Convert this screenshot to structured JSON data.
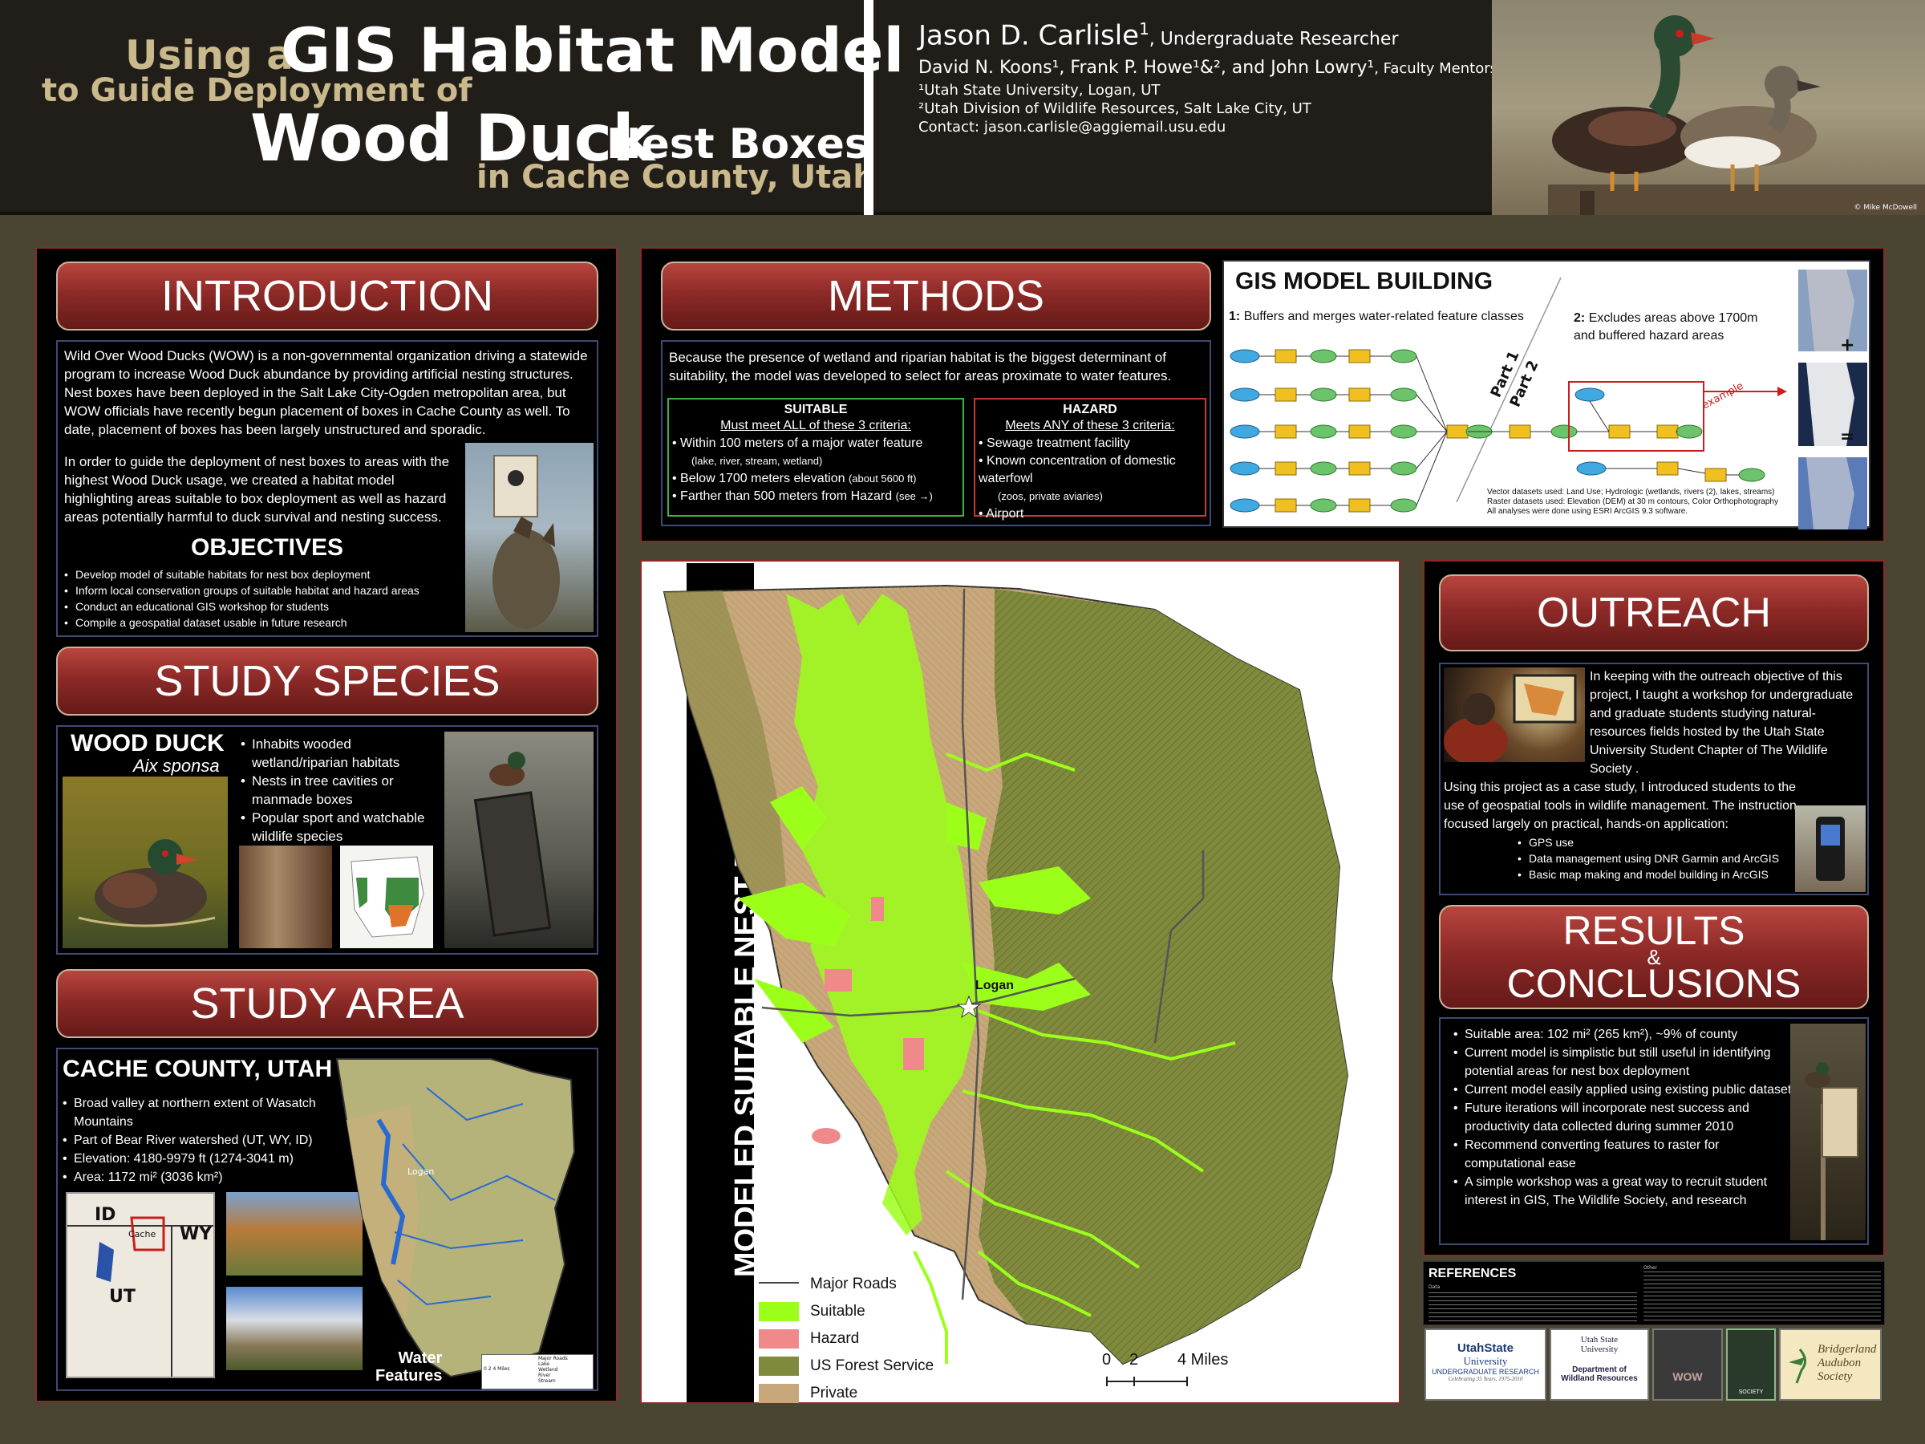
{
  "header": {
    "title_using_a": "Using a",
    "title_gis": "GIS Habitat Model",
    "title_guide": "to Guide Deployment of",
    "title_wood_duck": "Wood Duck",
    "title_nest_boxes": "Nest Boxes",
    "title_cache": "in Cache County, Utah",
    "lead_author": "Jason D. Carlisle",
    "lead_sup": "1",
    "lead_role": ", Undergraduate Researcher",
    "mentors": "David N. Koons¹, Frank P. Howe¹&², and John Lowry¹",
    "mentors_role": ", Faculty Mentors",
    "affil1": "¹Utah State University, Logan, UT",
    "affil2": "²Utah Division of Wildlife Resources, Salt Lake City, UT",
    "contact": "Contact: jason.carlisle@aggiemail.usu.edu",
    "photo_credit": "© Mike McDowell"
  },
  "introduction": {
    "banner": "INTRODUCTION",
    "para1": "Wild Over Wood Ducks (WOW) is a non-governmental organization driving a statewide program to increase Wood Duck abundance by providing artificial nesting structures.  Nest boxes have been deployed in the Salt Lake City-Ogden metropolitan area, but WOW officials have recently begun placement of boxes in Cache County as well.  To date, placement of boxes has been largely unstructured and sporadic.",
    "para2": "In order to guide the deployment of nest boxes to areas with the highest Wood Duck usage, we created a habitat model highlighting areas suitable to box deployment as well as hazard areas potentially harmful to duck survival and nesting success.",
    "objectives_title": "OBJECTIVES",
    "objectives": [
      "Develop model of suitable habitats for nest box deployment",
      "Inform local conservation groups of suitable habitat and hazard areas",
      "Conduct an educational GIS workshop for students",
      "Compile a geospatial dataset usable in future research"
    ]
  },
  "study_species": {
    "banner": "STUDY SPECIES",
    "name": "WOOD DUCK",
    "latin": "Aix sponsa",
    "bullets": [
      "Inhabits wooded wetland/riparian habitats",
      "Nests in tree cavities or manmade boxes",
      "Popular sport and watchable wildlife species"
    ]
  },
  "study_area": {
    "banner": "STUDY AREA",
    "title": "CACHE COUNTY, UTAH",
    "bullets": [
      "Broad valley at northern extent of Wasatch Mountains",
      "Part of Bear River watershed (UT, WY, ID)",
      "Elevation: 4180-9979 ft (1274-3041 m)",
      "Area: 1172 mi² (3036 km²)"
    ],
    "map_labels": {
      "id": "ID",
      "wy": "WY",
      "ut": "UT",
      "cache": "Cache"
    },
    "water_title_1": "Water",
    "water_title_2": "Features",
    "logan": "Logan",
    "legend_items": [
      "Major Roads",
      "Lake",
      "Wetland",
      "River",
      "Stream"
    ],
    "scale": "0 2 4 Miles"
  },
  "methods": {
    "banner": "METHODS",
    "intro": "Because the presence of wetland and riparian habitat is the biggest determinant of suitability, the model was developed to select for areas proximate to water features.",
    "suitable_title": "SUITABLE",
    "suitable_sub": "Must meet ALL of these 3 criteria:",
    "suitable_items": [
      "Within 100 meters of a major water feature",
      "(lake, river, stream, wetland)",
      "Below 1700 meters elevation",
      "(about 5600 ft)",
      "Farther than 500 meters from Hazard",
      "(see →)"
    ],
    "hazard_title": "HAZARD",
    "hazard_sub": "Meets ANY of these 3 criteria:",
    "hazard_items": [
      "Sewage treatment facility",
      "Known concentration of domestic waterfowl",
      "(zoos, private aviaries)",
      "Airport"
    ]
  },
  "gis_model": {
    "title": "GIS MODEL BUILDING",
    "step1_num": "1:",
    "step1": "Buffers and merges water-related feature classes",
    "step2_num": "2:",
    "step2": "Excludes areas above 1700m and buffered hazard areas",
    "part1": "Part 1",
    "part2": "Part 2",
    "example": "example",
    "note1": "Vector datasets used: Land Use; Hydrologic (wetlands, rivers (2), lakes, streams)",
    "note2": "Raster datasets used: Elevation (DEM) at 30 m contours, Color Orthophotography",
    "note3": "All analyses were done using ESRI ArcGIS 9.3 software.",
    "plus": "+",
    "equals": "="
  },
  "main_map": {
    "title": "MODELED SUITABLE NEST BOX HABITAT",
    "city": "Logan",
    "legend": [
      {
        "label": "Major Roads",
        "color": "#444444"
      },
      {
        "label": "Suitable",
        "color": "#9cff1a"
      },
      {
        "label": "Hazard",
        "color": "#f08a8a"
      },
      {
        "label": "US Forest Service",
        "color": "#7f8a3c"
      },
      {
        "label": "Private",
        "color": "#c6a77a"
      }
    ],
    "scale_0": "0",
    "scale_2": "2",
    "scale_4": "4 Miles"
  },
  "outreach": {
    "banner": "OUTREACH",
    "para1": "In keeping with the outreach objective of this project, I taught a workshop for undergraduate and graduate students studying natural-resources fields hosted by the Utah State University Student Chapter of The Wildlife Society .",
    "para2": "Using this project as a case study, I introduced students to the use of geospatial tools in wildlife management. The instruction focused largely on practical, hands-on application:",
    "items": [
      "GPS use",
      "Data management using DNR Garmin and ArcGIS",
      "Basic map making and model building in ArcGIS"
    ]
  },
  "results": {
    "banner_line1": "RESULTS",
    "banner_amp": "&",
    "banner_line2": "CONCLUSIONS",
    "bullets": [
      "Suitable area: 102 mi² (265 km²), ~9% of county",
      "Current model is simplistic but still useful in identifying potential areas for nest box deployment",
      "Current model easily applied using existing public datasets",
      "Future iterations will incorporate nest success and productivity data collected during summer 2010",
      "Recommend converting features to raster for computational ease",
      "A simple workshop was a great way to recruit student interest in GIS, The Wildlife Society, and research"
    ]
  },
  "references": {
    "title": "REFERENCES",
    "data_label": "Data",
    "other_label": "Other"
  },
  "logos": {
    "usu_line1": "UtahState",
    "usu_line2": "University",
    "usu_line3": "UNDERGRADUATE RESEARCH",
    "usu_line4": "Celebrating 35 Years, 1975-2010",
    "dwr_line1": "Utah State",
    "dwr_line2": "University",
    "dwr_line3": "Department of",
    "dwr_line4": "Wildland Resources",
    "wow": "WOW",
    "tws": "SOCIETY",
    "bas_line1": "Bridgerland",
    "bas_line2": "Audubon",
    "bas_line3": "Society"
  }
}
